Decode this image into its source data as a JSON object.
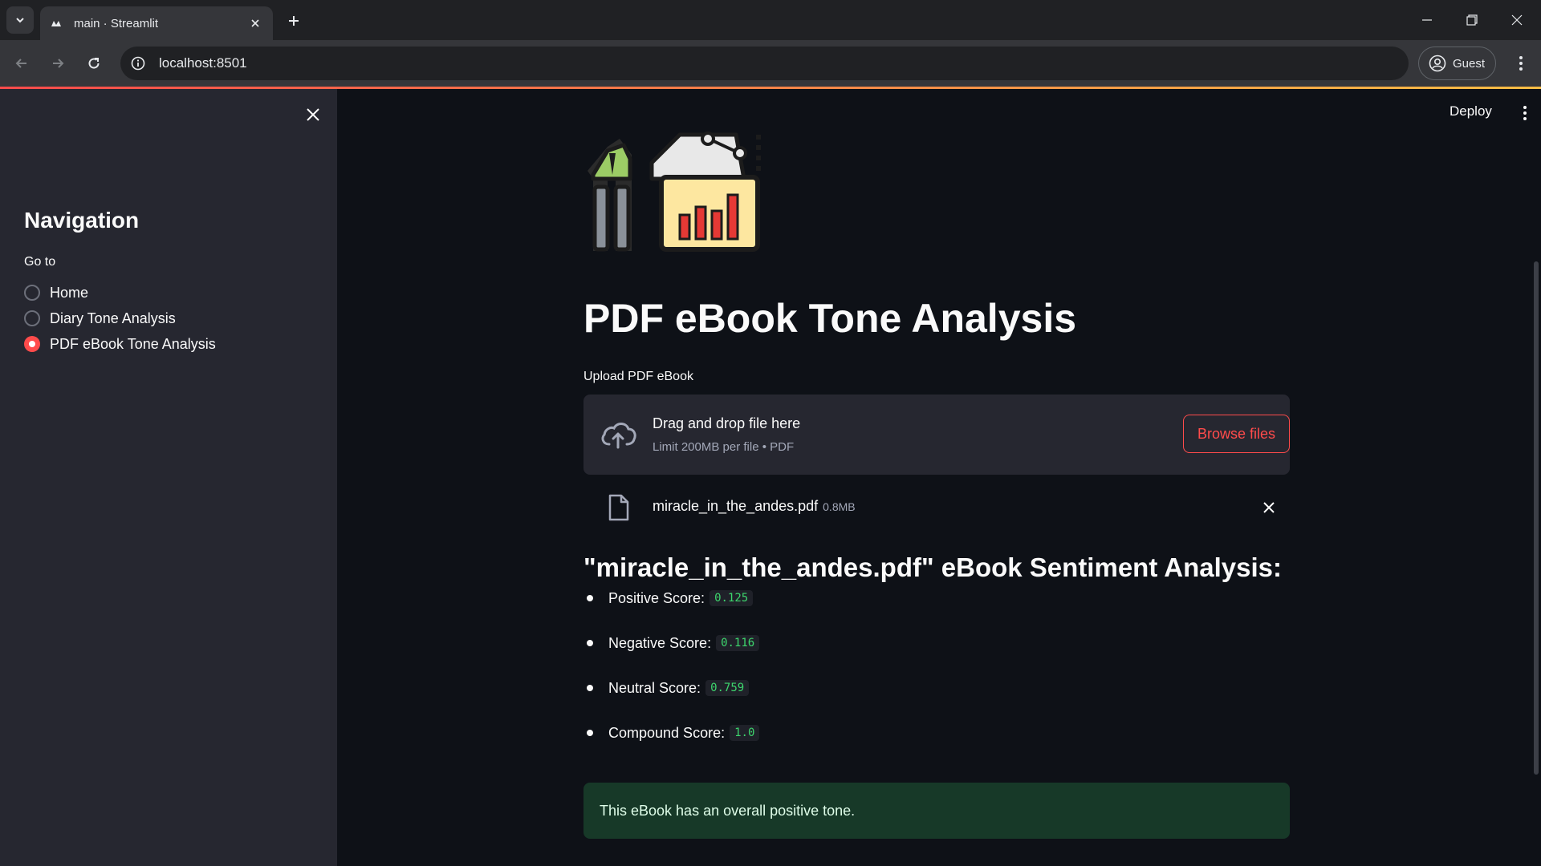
{
  "browser": {
    "tab_title": "main · Streamlit",
    "url": "localhost:8501",
    "profile_label": "Guest"
  },
  "sidebar": {
    "title": "Navigation",
    "radio_label": "Go to",
    "options": [
      {
        "label": "Home",
        "selected": false
      },
      {
        "label": "Diary Tone Analysis",
        "selected": false
      },
      {
        "label": "PDF eBook Tone Analysis",
        "selected": true
      }
    ]
  },
  "header": {
    "deploy_label": "Deploy"
  },
  "main": {
    "title": "PDF eBook Tone Analysis",
    "uploader": {
      "label": "Upload PDF eBook",
      "drop_text": "Drag and drop file here",
      "limit_text": "Limit 200MB per file • PDF",
      "browse_label": "Browse files"
    },
    "file": {
      "name": "miracle_in_the_andes.pdf",
      "size": "0.8MB"
    },
    "result_title": "\"miracle_in_the_andes.pdf\" eBook Sentiment Analysis:",
    "scores": [
      {
        "label": "Positive Score:",
        "value": "0.125"
      },
      {
        "label": "Negative Score:",
        "value": "0.116"
      },
      {
        "label": "Neutral Score:",
        "value": "0.759"
      },
      {
        "label": "Compound Score:",
        "value": "1.0"
      }
    ],
    "alert": "This eBook has an overall positive tone."
  },
  "colors": {
    "accent": "#ff4b4b",
    "background": "#0e1117",
    "sidebar": "#262730",
    "success_bg": "#173928",
    "code_text": "#3dd56d"
  }
}
